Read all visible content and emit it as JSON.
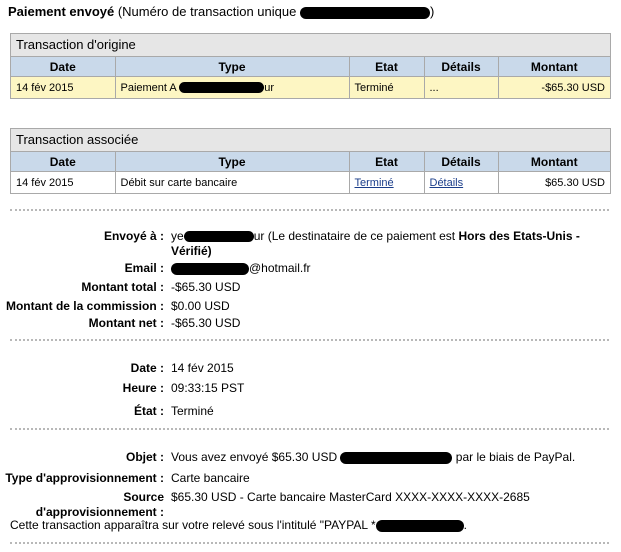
{
  "header": {
    "title_bold": "Paiement envoyé",
    "title_rest": "(Numéro de transaction unique"
  },
  "origin_table": {
    "caption": "Transaction d'origine",
    "columns": [
      "Date",
      "Type",
      "Etat",
      "Détails",
      "Montant"
    ],
    "row": {
      "date": "14 fév 2015",
      "type_prefix": "Paiement A",
      "type_suffix": "ur",
      "etat": "Terminé",
      "details": "...",
      "montant": "-$65.30 USD"
    }
  },
  "assoc_table": {
    "caption": "Transaction associée",
    "columns": [
      "Date",
      "Type",
      "Etat",
      "Détails",
      "Montant"
    ],
    "row": {
      "date": "14 fév 2015",
      "type": "Débit sur carte bancaire",
      "etat": "Terminé",
      "details": "Détails",
      "montant": "$65.30 USD"
    }
  },
  "recipient": {
    "envoye_label": "Envoyé à :",
    "envoye_prefix": "ye",
    "envoye_suffix": "ur (Le destinataire de ce paiement est",
    "envoye_bold": "Hors des Etats-Unis -",
    "envoye_line2": "Vérifié)",
    "email_label": "Email :",
    "email_suffix": "@hotmail.fr",
    "total_label": "Montant total :",
    "total_value": "-$65.30 USD",
    "commission_label": "Montant de la commission :",
    "commission_value": "$0.00 USD",
    "net_label": "Montant net :",
    "net_value": "-$65.30 USD"
  },
  "timing": {
    "date_label": "Date :",
    "date_value": "14 fév 2015",
    "heure_label": "Heure :",
    "heure_value": "09:33:15 PST",
    "etat_label": "État :",
    "etat_value": "Terminé"
  },
  "details": {
    "objet_label": "Objet :",
    "objet_prefix": "Vous avez envoyé $65.30 USD",
    "objet_suffix": "par le biais de PayPal.",
    "type_label": "Type d'approvisionnement :",
    "type_value": "Carte bancaire",
    "source_label_1": "Source",
    "source_label_2": "d'approvisionnement :",
    "source_value": "$65.30 USD - Carte bancaire MasterCard XXXX-XXXX-XXXX-2685",
    "note_prefix": "Cette transaction apparaîtra sur votre relevé sous l'intitulé \"PAYPAL *",
    "note_suffix": "."
  }
}
